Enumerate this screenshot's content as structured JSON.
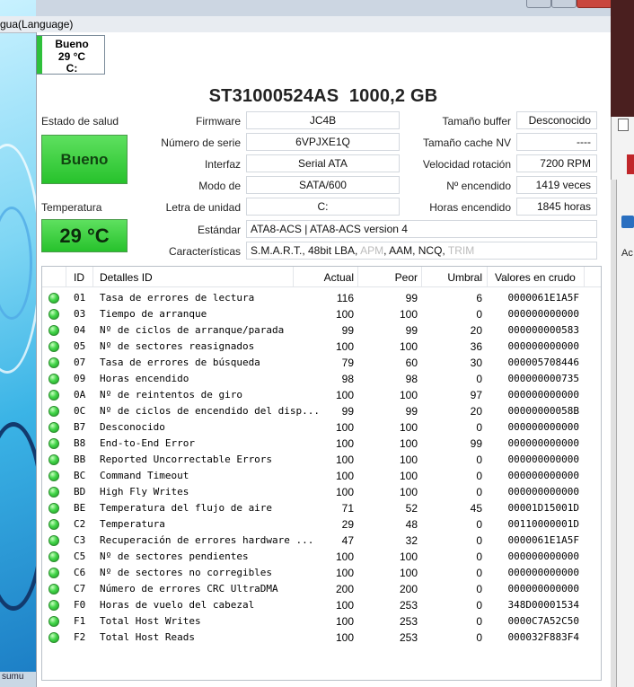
{
  "window": {
    "title_fragment": "gua(Language)"
  },
  "disk_tab": {
    "status": "Bueno",
    "temp": "29 °C",
    "drive": "C:"
  },
  "drive": {
    "model": "ST31000524AS  1000,2 GB"
  },
  "labels": {
    "health": "Estado de salud",
    "temperature": "Temperatura",
    "firmware": "Firmware",
    "serial": "Número de serie",
    "interface": "Interfaz",
    "transfer": "Modo de",
    "letter": "Letra de unidad",
    "standard": "Estándar",
    "features": "Características",
    "buffer": "Tamaño buffer",
    "nvcache": "Tamaño cache NV",
    "rotation": "Velocidad rotación",
    "poweron_count": "Nº encendido",
    "poweron_hours": "Horas encendido"
  },
  "values": {
    "health": "Bueno",
    "temperature": "29 °C",
    "firmware": "JC4B",
    "serial": "6VPJXE1Q",
    "interface": "Serial ATA",
    "transfer": "SATA/600",
    "letter": "C:",
    "standard": "ATA8-ACS | ATA8-ACS version 4",
    "features_active": "S.M.A.R.T., 48bit LBA, ",
    "features_apm": "APM",
    "features_mid": ", AAM, NCQ, ",
    "features_trim": "TRIM",
    "buffer": "Desconocido",
    "nvcache": "----",
    "rotation": "7200 RPM",
    "poweron_count": "1419 veces",
    "poweron_hours": "1845 horas"
  },
  "table": {
    "headers": {
      "id": "ID",
      "name": "Detalles ID",
      "current": "Actual",
      "worst": "Peor",
      "threshold": "Umbral",
      "raw": "Valores en crudo"
    },
    "rows": [
      {
        "id": "01",
        "name": "Tasa de errores de lectura",
        "cur": "116",
        "worst": "99",
        "thr": "6",
        "raw": "0000061E1A5F"
      },
      {
        "id": "03",
        "name": "Tiempo de arranque",
        "cur": "100",
        "worst": "100",
        "thr": "0",
        "raw": "000000000000"
      },
      {
        "id": "04",
        "name": "Nº de ciclos de arranque/parada",
        "cur": "99",
        "worst": "99",
        "thr": "20",
        "raw": "000000000583"
      },
      {
        "id": "05",
        "name": "Nº de sectores reasignados",
        "cur": "100",
        "worst": "100",
        "thr": "36",
        "raw": "000000000000"
      },
      {
        "id": "07",
        "name": "Tasa de errores de búsqueda",
        "cur": "79",
        "worst": "60",
        "thr": "30",
        "raw": "000005708446"
      },
      {
        "id": "09",
        "name": "Horas encendido",
        "cur": "98",
        "worst": "98",
        "thr": "0",
        "raw": "000000000735"
      },
      {
        "id": "0A",
        "name": "Nº de reintentos de giro",
        "cur": "100",
        "worst": "100",
        "thr": "97",
        "raw": "000000000000"
      },
      {
        "id": "0C",
        "name": "Nº de ciclos de encendido del disp...",
        "cur": "99",
        "worst": "99",
        "thr": "20",
        "raw": "00000000058B"
      },
      {
        "id": "B7",
        "name": "Desconocido",
        "cur": "100",
        "worst": "100",
        "thr": "0",
        "raw": "000000000000"
      },
      {
        "id": "B8",
        "name": "End-to-End Error",
        "cur": "100",
        "worst": "100",
        "thr": "99",
        "raw": "000000000000"
      },
      {
        "id": "BB",
        "name": "Reported Uncorrectable Errors",
        "cur": "100",
        "worst": "100",
        "thr": "0",
        "raw": "000000000000"
      },
      {
        "id": "BC",
        "name": "Command Timeout",
        "cur": "100",
        "worst": "100",
        "thr": "0",
        "raw": "000000000000"
      },
      {
        "id": "BD",
        "name": "High Fly Writes",
        "cur": "100",
        "worst": "100",
        "thr": "0",
        "raw": "000000000000"
      },
      {
        "id": "BE",
        "name": "Temperatura del flujo de aire",
        "cur": "71",
        "worst": "52",
        "thr": "45",
        "raw": "00001D15001D"
      },
      {
        "id": "C2",
        "name": "Temperatura",
        "cur": "29",
        "worst": "48",
        "thr": "0",
        "raw": "00110000001D"
      },
      {
        "id": "C3",
        "name": "Recuperación de errores hardware ...",
        "cur": "47",
        "worst": "32",
        "thr": "0",
        "raw": "0000061E1A5F"
      },
      {
        "id": "C5",
        "name": "Nº de sectores pendientes",
        "cur": "100",
        "worst": "100",
        "thr": "0",
        "raw": "000000000000"
      },
      {
        "id": "C6",
        "name": "Nº de sectores no corregibles",
        "cur": "100",
        "worst": "100",
        "thr": "0",
        "raw": "000000000000"
      },
      {
        "id": "C7",
        "name": "Número de errores CRC UltraDMA",
        "cur": "200",
        "worst": "200",
        "thr": "0",
        "raw": "000000000000"
      },
      {
        "id": "F0",
        "name": "Horas de vuelo del cabezal",
        "cur": "100",
        "worst": "253",
        "thr": "0",
        "raw": "348D00001534"
      },
      {
        "id": "F1",
        "name": "Total Host Writes",
        "cur": "100",
        "worst": "253",
        "thr": "0",
        "raw": "0000C7A52C50"
      },
      {
        "id": "F2",
        "name": "Total Host Reads",
        "cur": "100",
        "worst": "253",
        "thr": "0",
        "raw": "000032F883F4"
      }
    ]
  },
  "taskbar_fragment": "sumu",
  "right_fragment": "Ac",
  "colors": {
    "good": "#2fc03b",
    "accent_blue": "#2a6fc0"
  }
}
